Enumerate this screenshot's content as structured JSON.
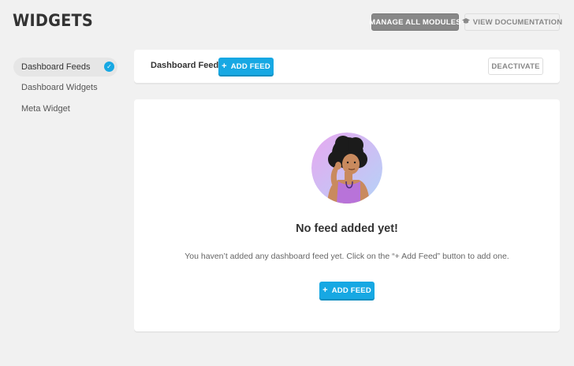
{
  "header": {
    "title": "WIDGETS",
    "manage_label": "MANAGE ALL MODULES",
    "docs_label": "VIEW DOCUMENTATION"
  },
  "sidebar": {
    "items": [
      {
        "label": "Dashboard Feeds",
        "active": true
      },
      {
        "label": "Dashboard Widgets",
        "active": false
      },
      {
        "label": "Meta Widget",
        "active": false
      }
    ]
  },
  "module_header": {
    "title": "Dashboard Feeds",
    "add_label": "ADD FEED",
    "deactivate_label": "DEACTIVATE"
  },
  "empty_state": {
    "title": "No feed added yet!",
    "description": "You haven’t added any dashboard feed yet. Click on the “+ Add Feed” button to add one.",
    "add_label": "ADD FEED"
  },
  "icons": {
    "docs": "graduation-cap-icon",
    "active_check": "check-icon",
    "add": "plus-icon"
  },
  "colors": {
    "accent": "#17a8e3",
    "manage_button": "#888888",
    "background": "#f1f1f1"
  }
}
